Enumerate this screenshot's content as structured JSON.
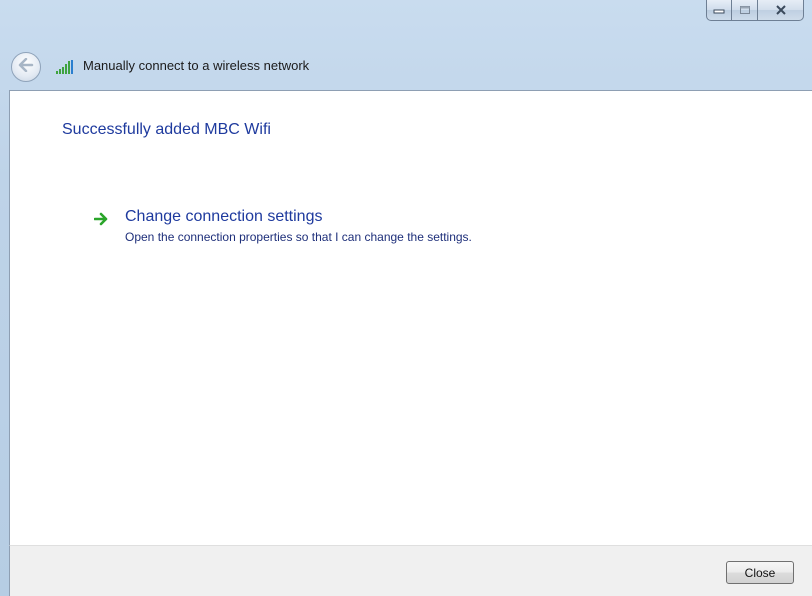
{
  "window": {
    "title": "Manually connect to a wireless network",
    "controls": {
      "minimize_icon": "minimize-icon",
      "maximize_icon": "maximize-icon",
      "close_icon": "close-icon"
    },
    "back_icon": "back-arrow-icon",
    "network_icon": "wireless-signal-icon"
  },
  "main": {
    "headline": "Successfully added MBC Wifi",
    "action": {
      "icon": "green-arrow-icon",
      "title": "Change connection settings",
      "description": "Open the connection properties so that I can change the settings."
    }
  },
  "footer": {
    "close_label": "Close"
  },
  "colors": {
    "link_blue": "#1e3a9e",
    "arrow_green": "#2aa52a",
    "glass_blue": "#bcd0e4"
  }
}
